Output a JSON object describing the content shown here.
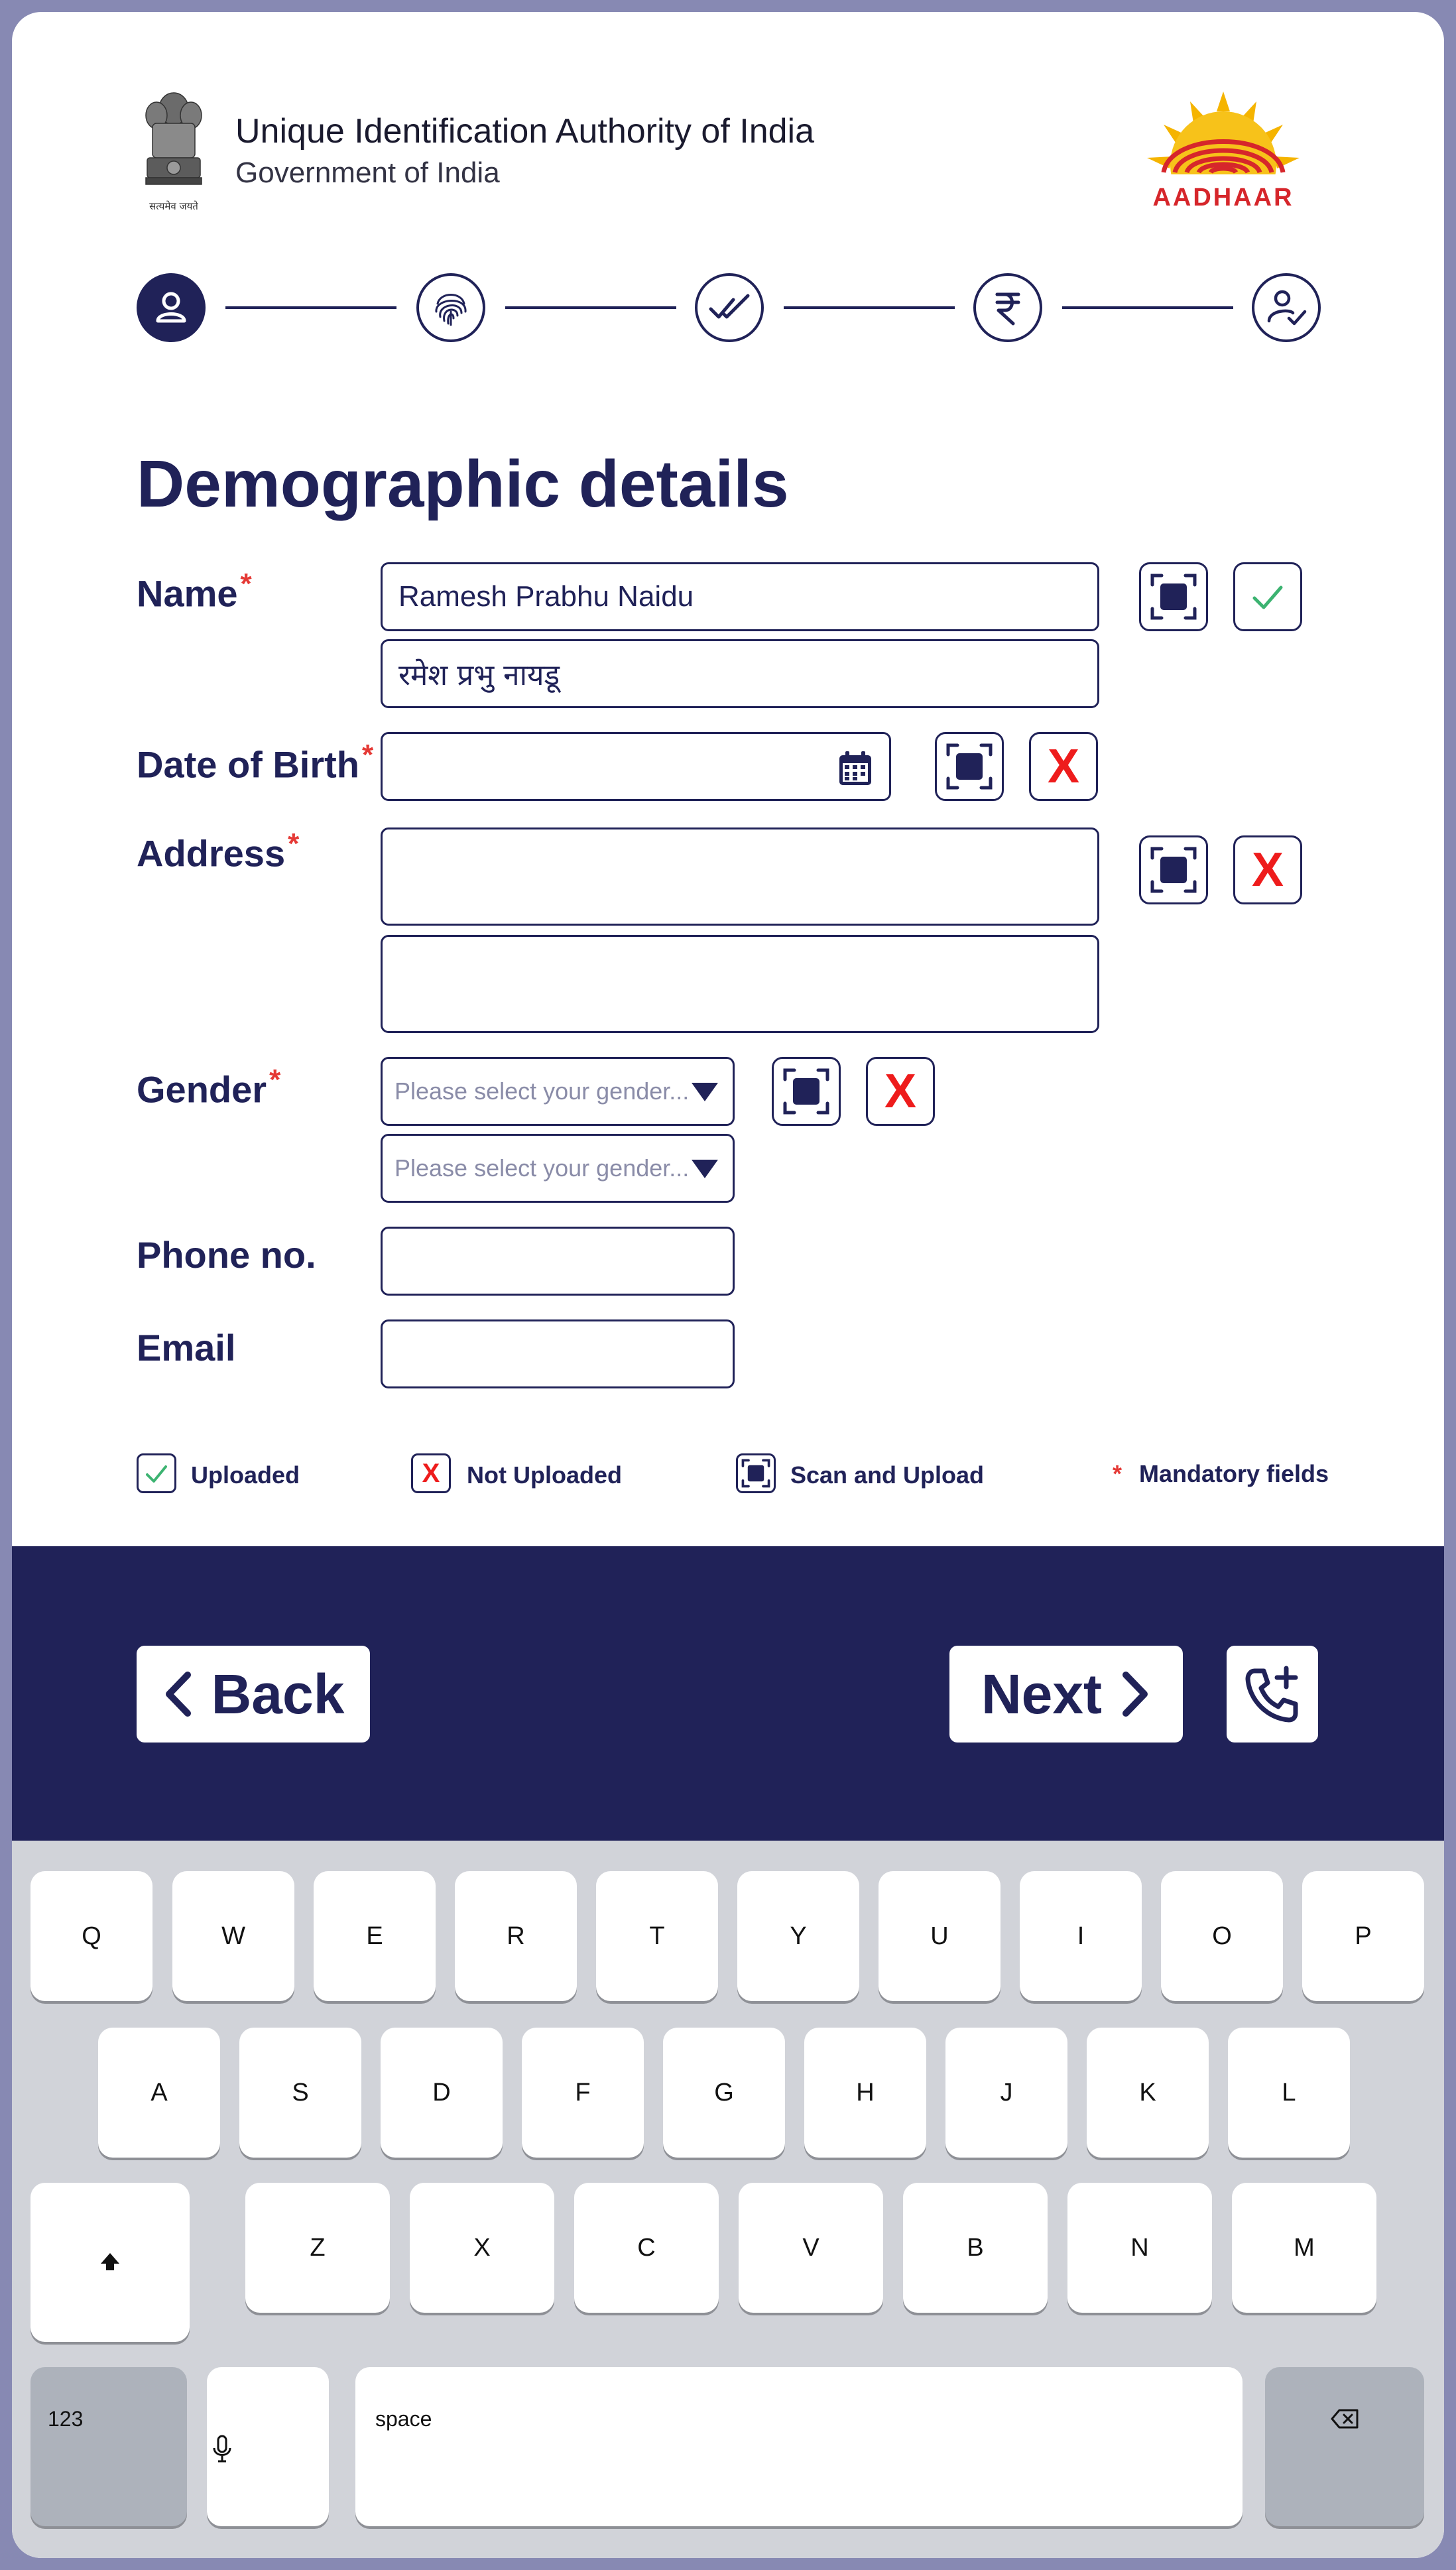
{
  "header": {
    "emblem_caption": "सत्यमेव जयते",
    "org_title": "Unique Identification Authority of India",
    "org_subtitle": "Government of India",
    "logo_text": "AADHAAR"
  },
  "stepper": {
    "steps": [
      {
        "icon": "person-icon",
        "state": "active"
      },
      {
        "icon": "fingerprint-icon",
        "state": "pending"
      },
      {
        "icon": "double-check-icon",
        "state": "pending"
      },
      {
        "icon": "rupee-icon",
        "state": "pending"
      },
      {
        "icon": "person-check-icon",
        "state": "pending"
      }
    ]
  },
  "form": {
    "title": "Demographic details",
    "required_mark": "*",
    "name": {
      "label": "Name",
      "value_en": "Ramesh Prabhu Naidu",
      "value_local": "रमेश प्रभु नायडू",
      "status": "uploaded"
    },
    "dob": {
      "label": "Date of Birth",
      "value": "",
      "status": "not_uploaded"
    },
    "address": {
      "label": "Address",
      "value_en": "",
      "value_local": "",
      "status": "not_uploaded"
    },
    "gender": {
      "label": "Gender",
      "placeholder": "Please select your gender...",
      "placeholder_local": "Please select your gender...",
      "status": "not_uploaded"
    },
    "phone": {
      "label": "Phone no.",
      "value": ""
    },
    "email": {
      "label": "Email",
      "value": ""
    },
    "x_mark": "X"
  },
  "legend": {
    "uploaded": "Uploaded",
    "not_uploaded": "Not Uploaded",
    "scan_upload": "Scan and Upload",
    "mandatory_mark": "*",
    "mandatory": "Mandatory fields"
  },
  "actions": {
    "back": "Back",
    "next": "Next",
    "call_icon": "phone-add-icon"
  },
  "keyboard": {
    "row1": [
      "Q",
      "W",
      "E",
      "R",
      "T",
      "Y",
      "U",
      "I",
      "O",
      "P"
    ],
    "row2": [
      "A",
      "S",
      "D",
      "F",
      "G",
      "H",
      "J",
      "K",
      "L"
    ],
    "row3": [
      "Z",
      "X",
      "C",
      "V",
      "B",
      "N",
      "M"
    ],
    "numbers": "123",
    "space": "space"
  },
  "colors": {
    "primary": "#202258",
    "required": "#e53935",
    "error": "#ee1c1c",
    "success": "#3cb371",
    "keyboard_bg": "#d1d3d9"
  }
}
